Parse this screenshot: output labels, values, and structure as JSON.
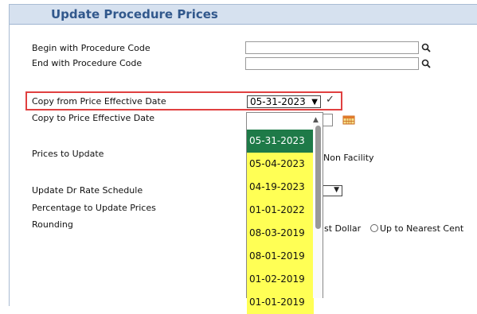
{
  "header": {
    "title": "Update Procedure Prices"
  },
  "form": {
    "begin_label": "Begin with Procedure Code",
    "end_label": "End with Procedure Code",
    "copy_from_label": "Copy from Price Effective Date",
    "copy_from_value": "05-31-2023",
    "copy_to_label": "Copy to Price Effective Date",
    "prices_label": "Prices to Update",
    "prices_partial": "Non Facility",
    "dr_rate_label": "Update Dr Rate Schedule",
    "percentage_label": "Percentage to Update Prices",
    "rounding_label": "Rounding",
    "rounding_opt1_partial": "st Dollar",
    "rounding_opt2_partial": "Up to Nearest Cent"
  },
  "dropdown": {
    "options": [
      "05-31-2023",
      "05-04-2023",
      "04-19-2023",
      "01-01-2022",
      "08-03-2019",
      "08-01-2019",
      "01-02-2019",
      "01-01-2019"
    ],
    "selected_index": 0
  },
  "colors": {
    "header_bg": "#d6e1ef",
    "header_text": "#31588c",
    "highlight_border": "#e04040",
    "option_bg": "#ffff55",
    "option_selected_bg": "#1e7a48"
  },
  "icons": {
    "search": "magnifier-icon",
    "confirm": "check-icon",
    "calendar": "calendar-icon"
  }
}
